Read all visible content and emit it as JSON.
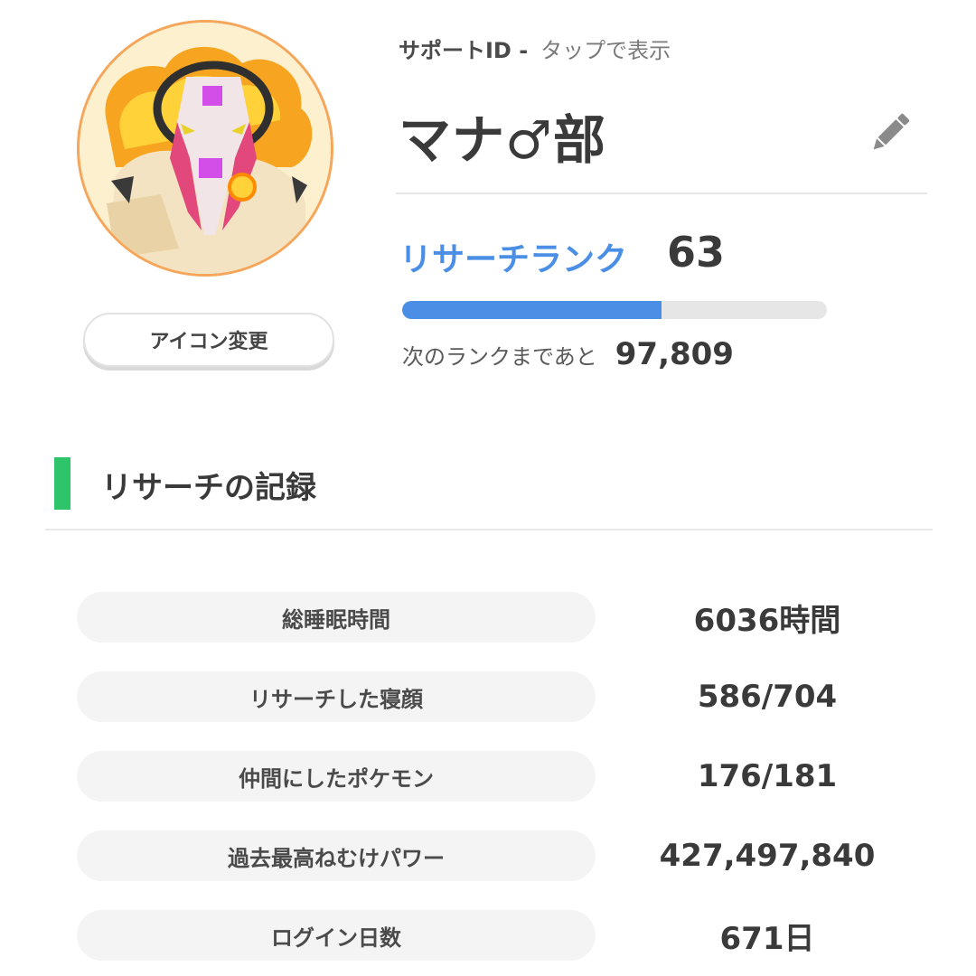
{
  "profile": {
    "support_id_label": "サポートID -",
    "support_id_tap": "タップで表示",
    "name": "マナ♂部",
    "icon_change_label": "アイコン変更",
    "avatar_icon": "pokemon-avatar-icon",
    "edit_icon": "pencil-icon"
  },
  "rank": {
    "label": "リサーチランク",
    "value": "63",
    "progress": 0.61,
    "next_label": "次のランクまであと",
    "next_value": "97,809"
  },
  "section": {
    "title": "リサーチの記録"
  },
  "stats": [
    {
      "label": "総睡眠時間",
      "value": "6036時間"
    },
    {
      "label": "リサーチした寝顔",
      "value": "586/704"
    },
    {
      "label": "仲間にしたポケモン",
      "value": "176/181"
    },
    {
      "label": "過去最高ねむけパワー",
      "value": "427,497,840"
    },
    {
      "label": "ログイン日数",
      "value": "671日"
    }
  ],
  "colors": {
    "accent_blue": "#4a8fe5",
    "section_green": "#2ec46a",
    "avatar_border": "#f5a65a"
  }
}
